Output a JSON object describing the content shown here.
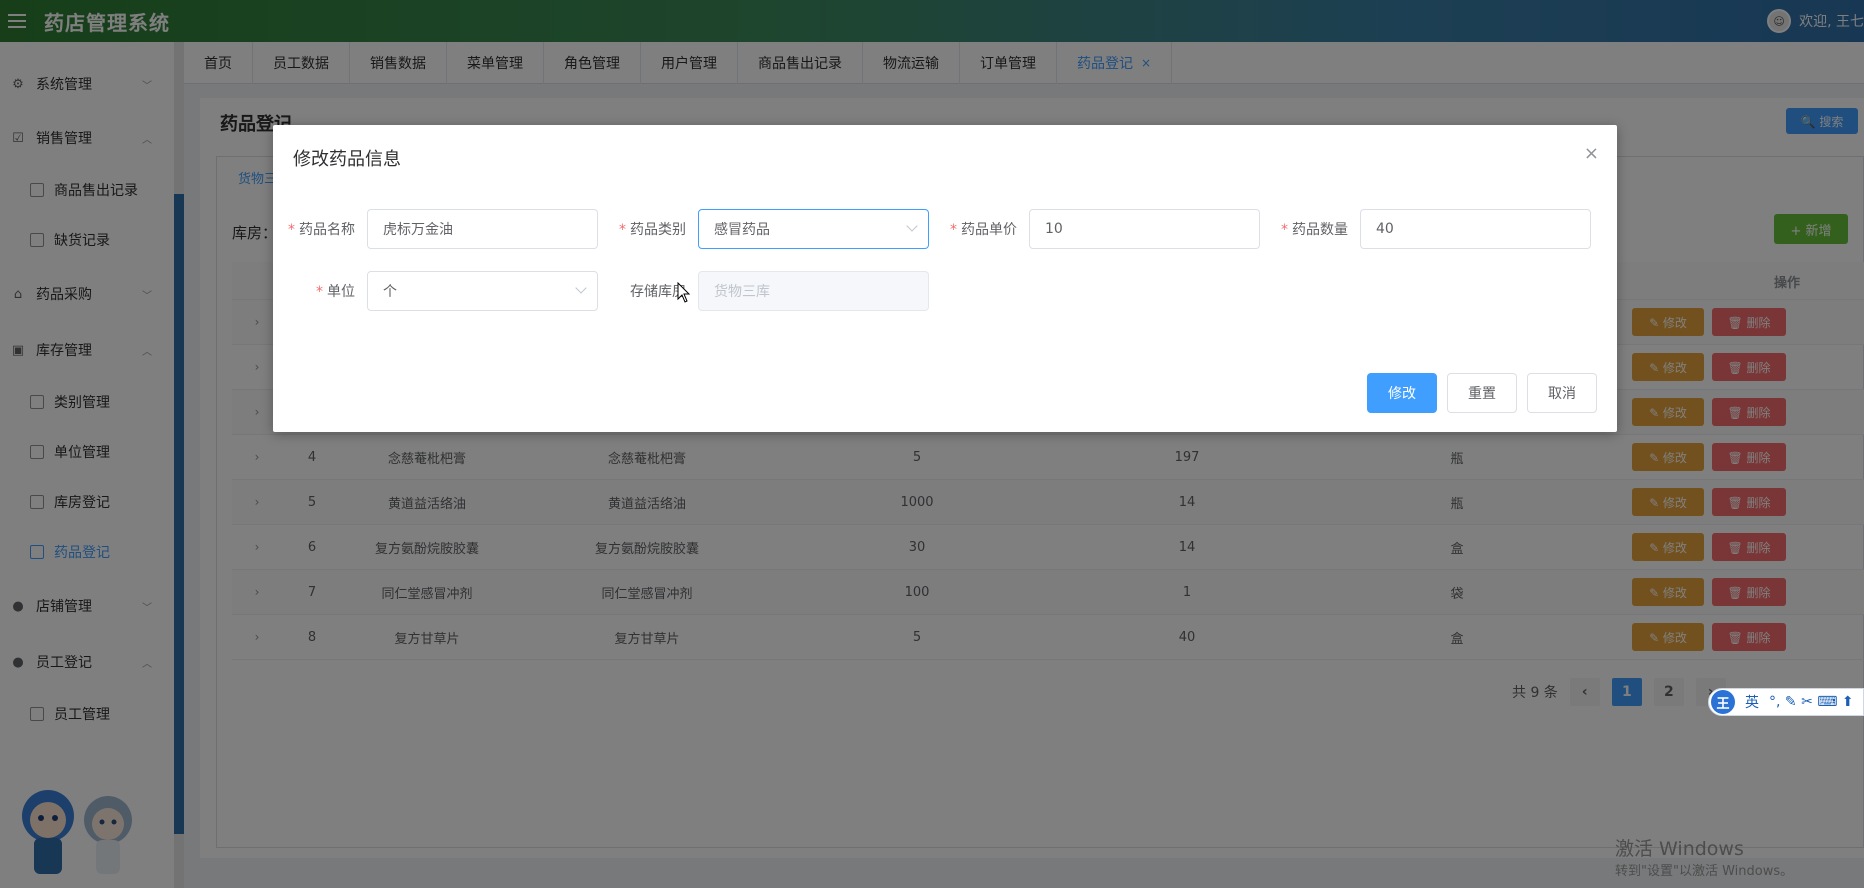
{
  "header": {
    "title": "药店管理系统",
    "welcome": "欢迎, 王七",
    "avatar_icon": "avatar-icon"
  },
  "sidebar": {
    "items": [
      {
        "label": "系统管理",
        "icon": "gear-icon",
        "chevron": "﹀"
      },
      {
        "label": "销售管理",
        "icon": "checkbox-icon",
        "chevron": "︿"
      },
      {
        "label": "商品售出记录",
        "icon": "truck-icon",
        "sub": true
      },
      {
        "label": "缺货记录",
        "icon": "bag-icon",
        "sub": true
      },
      {
        "label": "药品采购",
        "icon": "bank-icon",
        "chevron": "﹀"
      },
      {
        "label": "库存管理",
        "icon": "briefcase-icon",
        "chevron": "︿"
      },
      {
        "label": "类别管理",
        "icon": "document-icon",
        "sub": true
      },
      {
        "label": "单位管理",
        "icon": "calendar-icon",
        "sub": true
      },
      {
        "label": "库房登记",
        "icon": "house-icon",
        "sub": true
      },
      {
        "label": "药品登记",
        "icon": "box-icon",
        "sub": true,
        "active": true
      },
      {
        "label": "店铺管理",
        "icon": "user-icon",
        "chevron": "﹀"
      },
      {
        "label": "员工登记",
        "icon": "user-icon",
        "chevron": "︿"
      },
      {
        "label": "员工管理",
        "icon": "user-outline-icon",
        "sub": true
      }
    ]
  },
  "tabs": [
    {
      "label": "首页"
    },
    {
      "label": "员工数据"
    },
    {
      "label": "销售数据"
    },
    {
      "label": "菜单管理"
    },
    {
      "label": "角色管理"
    },
    {
      "label": "用户管理"
    },
    {
      "label": "商品售出记录"
    },
    {
      "label": "物流运输"
    },
    {
      "label": "订单管理"
    },
    {
      "label": "药品登记",
      "active": true,
      "close": "×"
    }
  ],
  "main": {
    "title": "药品登记",
    "search_label": "🔍 搜索",
    "inner_tab": "货物三",
    "store_label": "库房：",
    "add_label": "+ 新增",
    "ops_header": "操作",
    "edit_label": "✎ 修改",
    "delete_label": "🗑 删除",
    "rows": [
      {
        "idx": "",
        "name": "",
        "name2": "",
        "price": "",
        "qty": "",
        "unit": ""
      },
      {
        "idx": "",
        "name": "",
        "name2": "",
        "price": "",
        "qty": "",
        "unit": ""
      },
      {
        "idx": "",
        "name": "",
        "name2": "",
        "price": "",
        "qty": "",
        "unit": ""
      },
      {
        "idx": "4",
        "name": "念慈菴枇杷膏",
        "name2": "念慈菴枇杷膏",
        "price": "5",
        "qty": "197",
        "unit": "瓶"
      },
      {
        "idx": "5",
        "name": "黄道益活络油",
        "name2": "黄道益活络油",
        "price": "1000",
        "qty": "14",
        "unit": "瓶"
      },
      {
        "idx": "6",
        "name": "复方氨酚烷胺胶囊",
        "name2": "复方氨酚烷胺胶囊",
        "price": "30",
        "qty": "14",
        "unit": "盒"
      },
      {
        "idx": "7",
        "name": "同仁堂感冒冲剂",
        "name2": "同仁堂感冒冲剂",
        "price": "100",
        "qty": "1",
        "unit": "袋"
      },
      {
        "idx": "8",
        "name": "复方甘草片",
        "name2": "复方甘草片",
        "price": "5",
        "qty": "40",
        "unit": "盒"
      }
    ],
    "pager": {
      "total": "共 9 条",
      "prev": "‹",
      "pages": [
        "1",
        "2"
      ],
      "next": "›",
      "active_page": "1"
    }
  },
  "ime": {
    "logo": "王",
    "mode": "英",
    "extra": "°, ✎ ✂ ⌨ ⬆"
  },
  "watermark": {
    "line1": "激活 Windows",
    "line2": "转到\"设置\"以激活 Windows。"
  },
  "dialog": {
    "title": "修改药品信息",
    "close": "×",
    "fields": {
      "name": {
        "label": "药品名称",
        "value": "虎标万金油",
        "required": true
      },
      "category": {
        "label": "药品类别",
        "value": "感冒药品",
        "required": true
      },
      "price": {
        "label": "药品单价",
        "value": "10",
        "required": true
      },
      "qty": {
        "label": "药品数量",
        "value": "40",
        "required": true
      },
      "unit": {
        "label": "单位",
        "value": "个",
        "required": true
      },
      "store": {
        "label": "存储库房",
        "value": "货物三库",
        "required": false
      }
    },
    "buttons": {
      "submit": "修改",
      "reset": "重置",
      "cancel": "取消"
    }
  },
  "colors": {
    "primary": "#409eff",
    "warning": "#e6a23c",
    "danger": "#f56c6c",
    "success": "#67c23a"
  }
}
